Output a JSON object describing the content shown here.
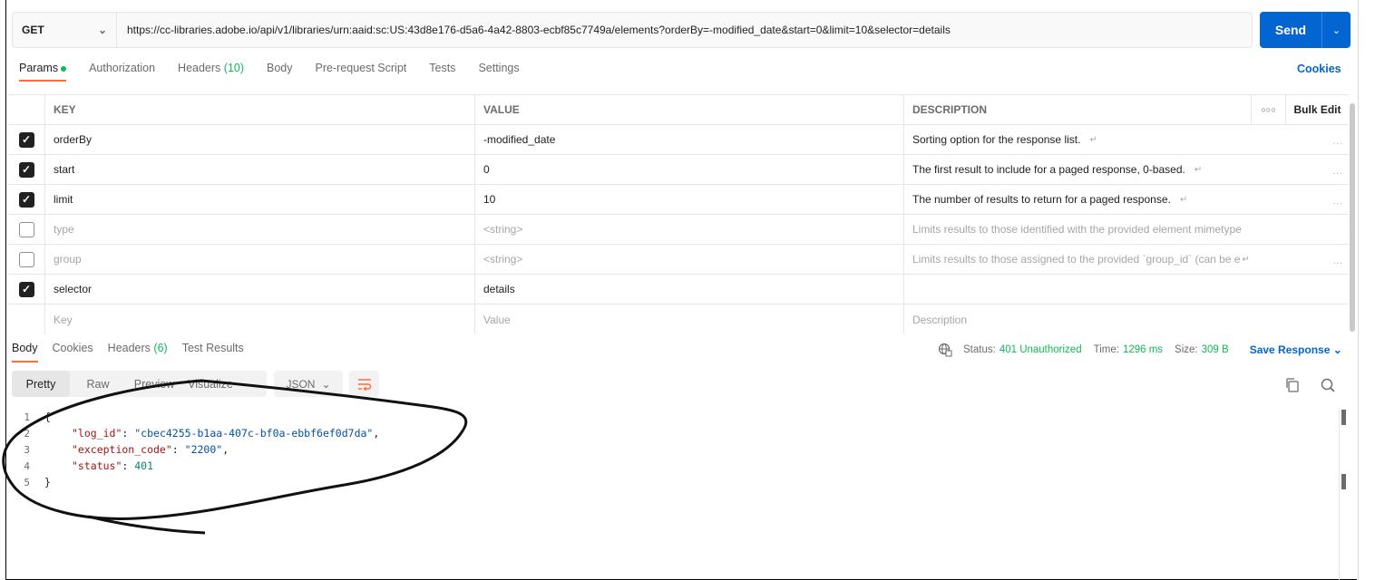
{
  "request": {
    "method": "GET",
    "url": "https://cc-libraries.adobe.io/api/v1/libraries/urn:aaid:sc:US:43d8e176-d5a6-4a42-8803-ecbf85c7749a/elements?orderBy=-modified_date&start=0&limit=10&selector=details",
    "send_label": "Send"
  },
  "request_tabs": {
    "params": "Params",
    "authorization": "Authorization",
    "headers": "Headers",
    "headers_count": "(10)",
    "body": "Body",
    "prerequest": "Pre-request Script",
    "tests": "Tests",
    "settings": "Settings",
    "cookies": "Cookies"
  },
  "params_table": {
    "headers": {
      "key": "KEY",
      "value": "VALUE",
      "description": "DESCRIPTION",
      "bulk_edit": "Bulk Edit"
    },
    "rows": [
      {
        "checked": true,
        "key": "orderBy",
        "value": "-modified_date",
        "description": "Sorting option for the response list."
      },
      {
        "checked": true,
        "key": "start",
        "value": "0",
        "description": "The first result to include for a paged response, 0-based."
      },
      {
        "checked": true,
        "key": "limit",
        "value": "10",
        "description": "The number of results to return for a paged response."
      },
      {
        "checked": false,
        "key": "type",
        "value": "<string>",
        "description": "Limits results to those identified with the provided element mimetype"
      },
      {
        "checked": false,
        "key": "group",
        "value": "<string>",
        "description": "Limits results to those assigned to the provided `group_id` (can be e"
      },
      {
        "checked": true,
        "key": "selector",
        "value": "details",
        "description": ""
      }
    ],
    "placeholders": {
      "key": "Key",
      "value": "Value",
      "description": "Description"
    }
  },
  "response_tabs": {
    "body": "Body",
    "cookies": "Cookies",
    "headers": "Headers",
    "headers_count": "(6)",
    "test_results": "Test Results"
  },
  "response_info": {
    "status_label": "Status:",
    "status_value": "401 Unauthorized",
    "time_label": "Time:",
    "time_value": "1296 ms",
    "size_label": "Size:",
    "size_value": "309 B",
    "save_response": "Save Response"
  },
  "view_modes": {
    "pretty": "Pretty",
    "raw": "Raw",
    "preview": "Preview",
    "visualize": "Visualize",
    "format": "JSON"
  },
  "response_body": {
    "line_numbers": [
      "1",
      "2",
      "3",
      "4",
      "5"
    ],
    "open_brace": "{",
    "close_brace": "}",
    "log_id_key": "\"log_id\"",
    "log_id_value": "\"cbec4255-b1aa-407c-bf0a-ebbf6ef0d7da\"",
    "exception_code_key": "\"exception_code\"",
    "exception_code_value": "\"2200\"",
    "status_key": "\"status\"",
    "status_value": "401"
  },
  "colors": {
    "accent": "#ff6c37",
    "primary": "#0265d2",
    "success": "#0cbb52"
  }
}
